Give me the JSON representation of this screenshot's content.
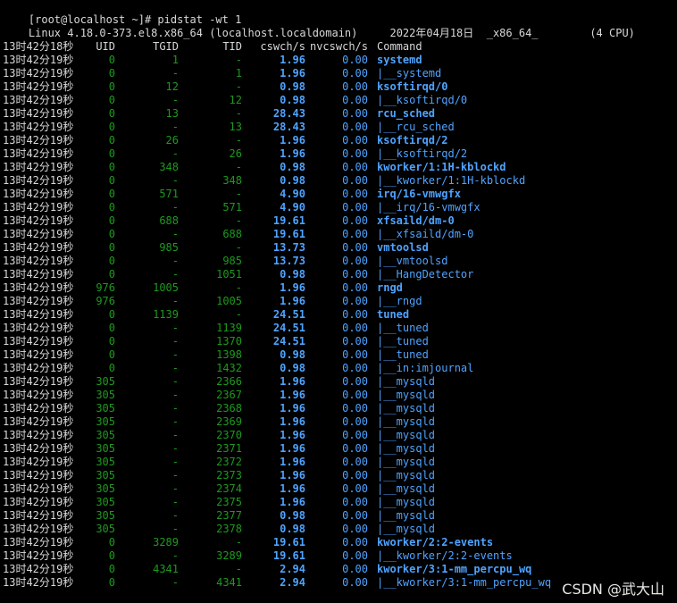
{
  "terminal": {
    "prompt": "[root@localhost ~]# pidstat -wt 1",
    "sysinfo": "Linux 4.18.0-373.el8.x86_64 (localhost.localdomain)     2022年04月18日  _x86_64_        (4 CPU)",
    "header": {
      "time": "13时42分18秒",
      "uid": "UID",
      "tgid": "TGID",
      "tid": "TID",
      "cswch": "cswch/s",
      "nvcswch": "nvcswch/s",
      "command": "Command"
    },
    "rows": [
      {
        "time": "13时42分19秒",
        "uid": "0",
        "tgid": "1",
        "tid": "-",
        "cswch": "1.96",
        "nvcswch": "0.00",
        "command": "systemd",
        "thread": false
      },
      {
        "time": "13时42分19秒",
        "uid": "0",
        "tgid": "-",
        "tid": "1",
        "cswch": "1.96",
        "nvcswch": "0.00",
        "command": "|__systemd",
        "thread": true
      },
      {
        "time": "13时42分19秒",
        "uid": "0",
        "tgid": "12",
        "tid": "-",
        "cswch": "0.98",
        "nvcswch": "0.00",
        "command": "ksoftirqd/0",
        "thread": false
      },
      {
        "time": "13时42分19秒",
        "uid": "0",
        "tgid": "-",
        "tid": "12",
        "cswch": "0.98",
        "nvcswch": "0.00",
        "command": "|__ksoftirqd/0",
        "thread": true
      },
      {
        "time": "13时42分19秒",
        "uid": "0",
        "tgid": "13",
        "tid": "-",
        "cswch": "28.43",
        "nvcswch": "0.00",
        "command": "rcu_sched",
        "thread": false
      },
      {
        "time": "13时42分19秒",
        "uid": "0",
        "tgid": "-",
        "tid": "13",
        "cswch": "28.43",
        "nvcswch": "0.00",
        "command": "|__rcu_sched",
        "thread": true
      },
      {
        "time": "13时42分19秒",
        "uid": "0",
        "tgid": "26",
        "tid": "-",
        "cswch": "1.96",
        "nvcswch": "0.00",
        "command": "ksoftirqd/2",
        "thread": false
      },
      {
        "time": "13时42分19秒",
        "uid": "0",
        "tgid": "-",
        "tid": "26",
        "cswch": "1.96",
        "nvcswch": "0.00",
        "command": "|__ksoftirqd/2",
        "thread": true
      },
      {
        "time": "13时42分19秒",
        "uid": "0",
        "tgid": "348",
        "tid": "-",
        "cswch": "0.98",
        "nvcswch": "0.00",
        "command": "kworker/1:1H-kblockd",
        "thread": false
      },
      {
        "time": "13时42分19秒",
        "uid": "0",
        "tgid": "-",
        "tid": "348",
        "cswch": "0.98",
        "nvcswch": "0.00",
        "command": "|__kworker/1:1H-kblockd",
        "thread": true
      },
      {
        "time": "13时42分19秒",
        "uid": "0",
        "tgid": "571",
        "tid": "-",
        "cswch": "4.90",
        "nvcswch": "0.00",
        "command": "irq/16-vmwgfx",
        "thread": false
      },
      {
        "time": "13时42分19秒",
        "uid": "0",
        "tgid": "-",
        "tid": "571",
        "cswch": "4.90",
        "nvcswch": "0.00",
        "command": "|__irq/16-vmwgfx",
        "thread": true
      },
      {
        "time": "13时42分19秒",
        "uid": "0",
        "tgid": "688",
        "tid": "-",
        "cswch": "19.61",
        "nvcswch": "0.00",
        "command": "xfsaild/dm-0",
        "thread": false
      },
      {
        "time": "13时42分19秒",
        "uid": "0",
        "tgid": "-",
        "tid": "688",
        "cswch": "19.61",
        "nvcswch": "0.00",
        "command": "|__xfsaild/dm-0",
        "thread": true
      },
      {
        "time": "13时42分19秒",
        "uid": "0",
        "tgid": "985",
        "tid": "-",
        "cswch": "13.73",
        "nvcswch": "0.00",
        "command": "vmtoolsd",
        "thread": false
      },
      {
        "time": "13时42分19秒",
        "uid": "0",
        "tgid": "-",
        "tid": "985",
        "cswch": "13.73",
        "nvcswch": "0.00",
        "command": "|__vmtoolsd",
        "thread": true
      },
      {
        "time": "13时42分19秒",
        "uid": "0",
        "tgid": "-",
        "tid": "1051",
        "cswch": "0.98",
        "nvcswch": "0.00",
        "command": "|__HangDetector",
        "thread": true
      },
      {
        "time": "13时42分19秒",
        "uid": "976",
        "tgid": "1005",
        "tid": "-",
        "cswch": "1.96",
        "nvcswch": "0.00",
        "command": "rngd",
        "thread": false
      },
      {
        "time": "13时42分19秒",
        "uid": "976",
        "tgid": "-",
        "tid": "1005",
        "cswch": "1.96",
        "nvcswch": "0.00",
        "command": "|__rngd",
        "thread": true
      },
      {
        "time": "13时42分19秒",
        "uid": "0",
        "tgid": "1139",
        "tid": "-",
        "cswch": "24.51",
        "nvcswch": "0.00",
        "command": "tuned",
        "thread": false
      },
      {
        "time": "13时42分19秒",
        "uid": "0",
        "tgid": "-",
        "tid": "1139",
        "cswch": "24.51",
        "nvcswch": "0.00",
        "command": "|__tuned",
        "thread": true
      },
      {
        "time": "13时42分19秒",
        "uid": "0",
        "tgid": "-",
        "tid": "1370",
        "cswch": "24.51",
        "nvcswch": "0.00",
        "command": "|__tuned",
        "thread": true
      },
      {
        "time": "13时42分19秒",
        "uid": "0",
        "tgid": "-",
        "tid": "1398",
        "cswch": "0.98",
        "nvcswch": "0.00",
        "command": "|__tuned",
        "thread": true
      },
      {
        "time": "13时42分19秒",
        "uid": "0",
        "tgid": "-",
        "tid": "1432",
        "cswch": "0.98",
        "nvcswch": "0.00",
        "command": "|__in:imjournal",
        "thread": true
      },
      {
        "time": "13时42分19秒",
        "uid": "305",
        "tgid": "-",
        "tid": "2366",
        "cswch": "1.96",
        "nvcswch": "0.00",
        "command": "|__mysqld",
        "thread": true
      },
      {
        "time": "13时42分19秒",
        "uid": "305",
        "tgid": "-",
        "tid": "2367",
        "cswch": "1.96",
        "nvcswch": "0.00",
        "command": "|__mysqld",
        "thread": true
      },
      {
        "time": "13时42分19秒",
        "uid": "305",
        "tgid": "-",
        "tid": "2368",
        "cswch": "1.96",
        "nvcswch": "0.00",
        "command": "|__mysqld",
        "thread": true
      },
      {
        "time": "13时42分19秒",
        "uid": "305",
        "tgid": "-",
        "tid": "2369",
        "cswch": "1.96",
        "nvcswch": "0.00",
        "command": "|__mysqld",
        "thread": true
      },
      {
        "time": "13时42分19秒",
        "uid": "305",
        "tgid": "-",
        "tid": "2370",
        "cswch": "1.96",
        "nvcswch": "0.00",
        "command": "|__mysqld",
        "thread": true
      },
      {
        "time": "13时42分19秒",
        "uid": "305",
        "tgid": "-",
        "tid": "2371",
        "cswch": "1.96",
        "nvcswch": "0.00",
        "command": "|__mysqld",
        "thread": true
      },
      {
        "time": "13时42分19秒",
        "uid": "305",
        "tgid": "-",
        "tid": "2372",
        "cswch": "1.96",
        "nvcswch": "0.00",
        "command": "|__mysqld",
        "thread": true
      },
      {
        "time": "13时42分19秒",
        "uid": "305",
        "tgid": "-",
        "tid": "2373",
        "cswch": "1.96",
        "nvcswch": "0.00",
        "command": "|__mysqld",
        "thread": true
      },
      {
        "time": "13时42分19秒",
        "uid": "305",
        "tgid": "-",
        "tid": "2374",
        "cswch": "1.96",
        "nvcswch": "0.00",
        "command": "|__mysqld",
        "thread": true
      },
      {
        "time": "13时42分19秒",
        "uid": "305",
        "tgid": "-",
        "tid": "2375",
        "cswch": "1.96",
        "nvcswch": "0.00",
        "command": "|__mysqld",
        "thread": true
      },
      {
        "time": "13时42分19秒",
        "uid": "305",
        "tgid": "-",
        "tid": "2377",
        "cswch": "0.98",
        "nvcswch": "0.00",
        "command": "|__mysqld",
        "thread": true
      },
      {
        "time": "13时42分19秒",
        "uid": "305",
        "tgid": "-",
        "tid": "2378",
        "cswch": "0.98",
        "nvcswch": "0.00",
        "command": "|__mysqld",
        "thread": true
      },
      {
        "time": "13时42分19秒",
        "uid": "0",
        "tgid": "3289",
        "tid": "-",
        "cswch": "19.61",
        "nvcswch": "0.00",
        "command": "kworker/2:2-events",
        "thread": false
      },
      {
        "time": "13时42分19秒",
        "uid": "0",
        "tgid": "-",
        "tid": "3289",
        "cswch": "19.61",
        "nvcswch": "0.00",
        "command": "|__kworker/2:2-events",
        "thread": true
      },
      {
        "time": "13时42分19秒",
        "uid": "0",
        "tgid": "4341",
        "tid": "-",
        "cswch": "2.94",
        "nvcswch": "0.00",
        "command": "kworker/3:1-mm_percpu_wq",
        "thread": false
      },
      {
        "time": "13时42分19秒",
        "uid": "0",
        "tgid": "-",
        "tid": "4341",
        "cswch": "2.94",
        "nvcswch": "0.00",
        "command": "|__kworker/3:1-mm_percpu_wq",
        "thread": true
      }
    ]
  },
  "watermark": "CSDN @武大山",
  "colors": {
    "background": "#000000",
    "foreground": "#d8d8d8",
    "id_green": "#1d9a1d",
    "value_blue": "#4fa3ff"
  }
}
